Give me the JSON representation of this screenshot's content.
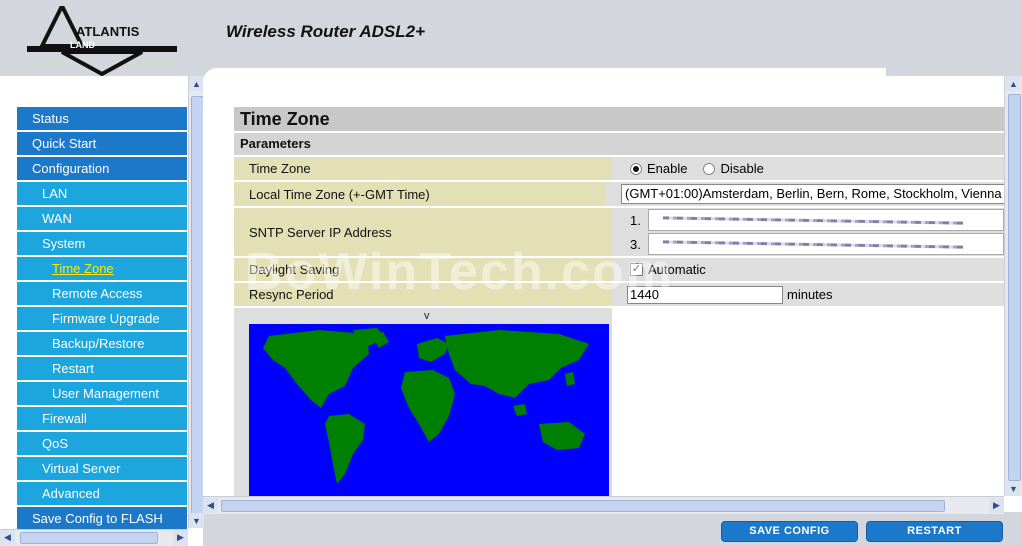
{
  "brand": {
    "name": "ATLANTIS",
    "sub": "LAND"
  },
  "header": {
    "product_title": "Wireless Router ADSL2+"
  },
  "nav": {
    "items": [
      {
        "label": "Status",
        "level": 1
      },
      {
        "label": "Quick Start",
        "level": 1
      },
      {
        "label": "Configuration",
        "level": 1
      },
      {
        "label": "LAN",
        "level": 2
      },
      {
        "label": "WAN",
        "level": 2
      },
      {
        "label": "System",
        "level": 2
      },
      {
        "label": "Time Zone",
        "level": 3,
        "active": true
      },
      {
        "label": "Remote Access",
        "level": 3
      },
      {
        "label": "Firmware Upgrade",
        "level": 3
      },
      {
        "label": "Backup/Restore",
        "level": 3
      },
      {
        "label": "Restart",
        "level": 3
      },
      {
        "label": "User Management",
        "level": 3
      },
      {
        "label": "Firewall",
        "level": 2
      },
      {
        "label": "QoS",
        "level": 2
      },
      {
        "label": "Virtual Server",
        "level": 2
      },
      {
        "label": "Advanced",
        "level": 2
      },
      {
        "label": "Save Config to FLASH",
        "level": 1
      }
    ]
  },
  "page": {
    "title": "Time Zone",
    "section": "Parameters",
    "time_zone": {
      "label": "Time Zone",
      "enable_label": "Enable",
      "disable_label": "Disable",
      "selected": "Enable"
    },
    "local_tz": {
      "label": "Local Time Zone (+-GMT Time)",
      "value": "(GMT+01:00)Amsterdam, Berlin, Bern, Rome, Stockholm, Vienna"
    },
    "sntp": {
      "label": "SNTP Server IP Address",
      "server1_num": "1.",
      "server2_num": "3."
    },
    "daylight": {
      "label": "Daylight Saving",
      "checkbox_label": "Automatic",
      "checked": true
    },
    "resync": {
      "label": "Resync Period",
      "value": "1440",
      "unit": "minutes"
    },
    "map_marker": "v"
  },
  "footer": {
    "save_label": "SAVE CONFIG",
    "restart_label": "RESTART"
  },
  "watermark": "BoWinTech.com",
  "colors": {
    "nav_primary": "#1c78c8",
    "nav_secondary": "#1da6de",
    "label_bg": "#e3e0b5",
    "map_sea": "#0000ff",
    "map_land": "#008000"
  }
}
